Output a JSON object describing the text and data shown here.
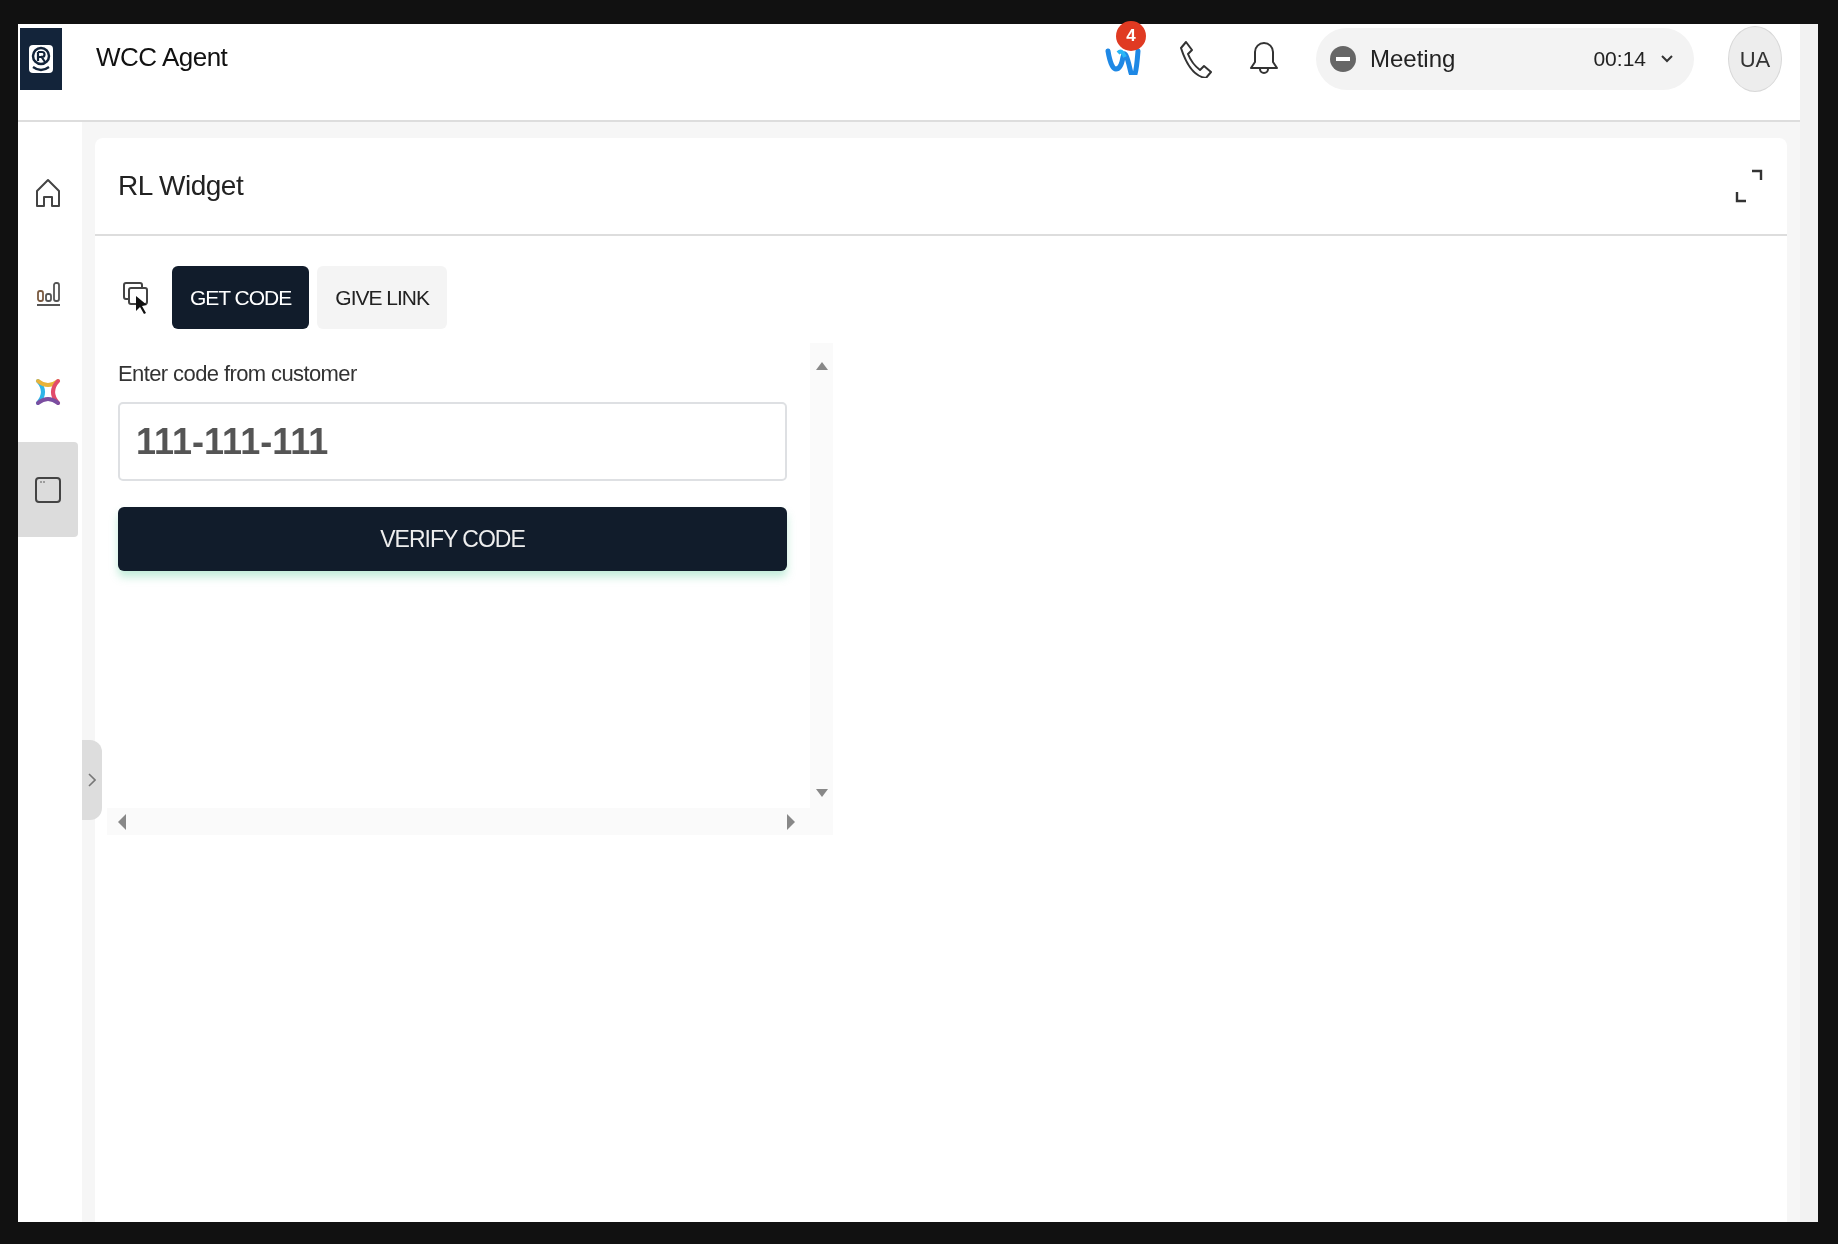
{
  "app": {
    "title": "WCC Agent"
  },
  "header": {
    "notification_badge": "4",
    "status": {
      "label": "Meeting",
      "timer": "00:14"
    },
    "avatar": "UA"
  },
  "sidebar": {
    "items": [
      {
        "kind": "home",
        "selected": false
      },
      {
        "kind": "stats",
        "selected": false
      },
      {
        "kind": "cross",
        "selected": false
      },
      {
        "kind": "window",
        "selected": true
      }
    ]
  },
  "widget": {
    "title": "RL Widget",
    "tabs": [
      {
        "label": "GET CODE",
        "selected": true
      },
      {
        "label": "GIVE LINK",
        "selected": false
      }
    ],
    "field": {
      "label": "Enter code from customer",
      "value": "111-111-111"
    },
    "button": "VERIFY CODE"
  }
}
